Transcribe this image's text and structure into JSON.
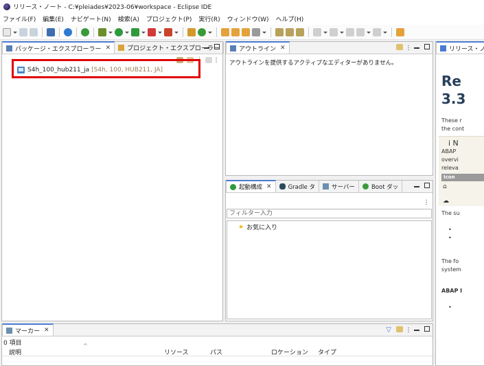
{
  "window": {
    "title": "リリース・ノート - C:¥pleiades¥2023-06¥workspace - Eclipse IDE"
  },
  "menu": [
    "ファイル(F)",
    "編集(E)",
    "ナビゲート(N)",
    "検索(A)",
    "プロジェクト(P)",
    "実行(R)",
    "ウィンドウ(W)",
    "ヘルプ(H)"
  ],
  "explorer": {
    "tabs": [
      "パッケージ・エクスプローラー",
      "プロジェクト・エクスプローラー"
    ],
    "project": {
      "name": "S4h_100_hub211_ja",
      "decoration": "[S4h, 100, HUB211, JA]"
    }
  },
  "outline": {
    "tab": "アウトライン",
    "message": "アウトラインを提供するアクティブなエディターがありません。"
  },
  "launch": {
    "tabs": [
      "起動構成",
      "Gradle タ",
      "サーバー",
      "Boot ダッ"
    ],
    "filter_placeholder": "フィルター入力",
    "favorites": "お気に入り"
  },
  "markers": {
    "tab": "マーカー",
    "count": "0 項目",
    "columns": [
      "説明",
      "リソース",
      "パス",
      "ロケーション",
      "タイプ"
    ]
  },
  "release_notes": {
    "tab": "リリース・ノート",
    "heading_1": "Re",
    "heading_2": "3.3",
    "para_1": "These r",
    "para_2": "the cont",
    "note_title": "i N",
    "note_1": "ABAP",
    "note_2": "overvi",
    "note_3": "releva",
    "table_header": "Icon",
    "the_su": "The su",
    "the_fo": "The fo",
    "system": "system",
    "abap": "ABAP I"
  }
}
